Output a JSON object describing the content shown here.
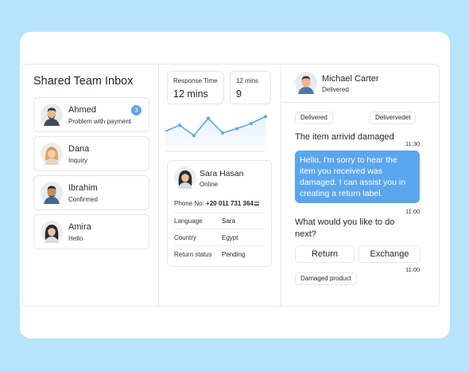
{
  "inbox": {
    "title": "Shared Team Inbox",
    "contacts": [
      {
        "name": "Ahmed",
        "sub": "Problem with payment",
        "badge": "3"
      },
      {
        "name": "Dana",
        "sub": "Inquiry"
      },
      {
        "name": "Ibrahim",
        "sub": "Confirmed"
      },
      {
        "name": "Amira",
        "sub": "Hello"
      }
    ]
  },
  "stats": {
    "response": {
      "label": "Response Time",
      "value": "12 mins"
    },
    "second": {
      "label": "12 mins",
      "value": "9"
    }
  },
  "chart_data": {
    "type": "line",
    "values": [
      40,
      47,
      35,
      55,
      38,
      43,
      49,
      57
    ],
    "color": "#5aa6ee"
  },
  "profile": {
    "name": "Sara Hasan",
    "status": "Online",
    "phone_label": "Phone No:",
    "phone": "+20 011 731 364",
    "rows": [
      {
        "key": "Language",
        "value": "Sara"
      },
      {
        "key": "Country",
        "value": "Egypt"
      },
      {
        "key": "Return status",
        "value": "Pending"
      }
    ]
  },
  "chat": {
    "name": "Michael Carter",
    "status": "Delivered",
    "pill_1": "Delivered",
    "pill_2": "Delivervedet",
    "msg_1": "The item arrivid damaged",
    "time_1": "11:30",
    "bubble": "Hello, I'm sorry to hear the item you received was damaged. I can assist you in creating a return label.",
    "time_2": "11:00",
    "msg_2": "What would you like to do next?",
    "btn_return": "Return",
    "btn_exchange": "Exchange",
    "time_3": "11:00",
    "pill_3": "Damaged product"
  },
  "colors": {
    "accent": "#5aa6ee",
    "background": "#b7e4fb"
  }
}
